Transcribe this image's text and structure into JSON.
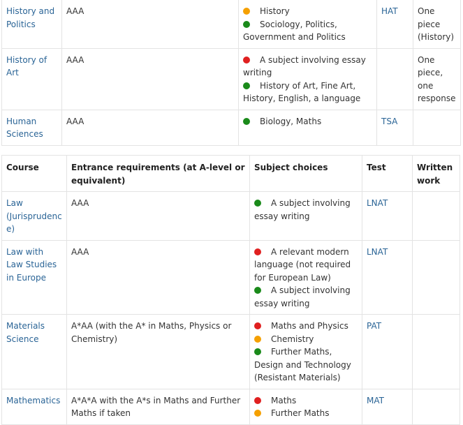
{
  "colors": {
    "red": "#e02020",
    "amber": "#f5a000",
    "green": "#1a8a1a",
    "link": "#2a6496"
  },
  "table1": {
    "rows": [
      {
        "course": "History and Politics",
        "req": "AAA",
        "subjects": [
          {
            "c": "amber",
            "t": "History"
          },
          {
            "c": "green",
            "t": "Sociology, Politics, Government and Politics"
          }
        ],
        "test": "HAT",
        "work": "One piece (History)"
      },
      {
        "course": "History of Art",
        "req": "AAA",
        "subjects": [
          {
            "c": "red",
            "t": "A subject involving essay writing"
          },
          {
            "c": "green",
            "t": "History of Art, Fine Art, History, English, a language"
          }
        ],
        "test": "",
        "work": "One piece, one response"
      },
      {
        "course": "Human Sciences",
        "req": "AAA",
        "subjects": [
          {
            "c": "green",
            "t": "Biology, Maths"
          }
        ],
        "test": "TSA",
        "work": ""
      }
    ]
  },
  "table2": {
    "headers": {
      "course": "Course",
      "req": "Entrance requirements (at A-level or equivalent)",
      "subjects": "Subject choices",
      "test": "Test",
      "work": "Written work"
    },
    "rows": [
      {
        "course": "Law (Jurisprudence)",
        "req": "AAA",
        "subjects": [
          {
            "c": "green",
            "t": "A subject involving essay writing"
          }
        ],
        "test": "LNAT",
        "work": ""
      },
      {
        "course": "Law with Law Studies in Europe",
        "req": "AAA",
        "subjects": [
          {
            "c": "red",
            "t": "A relevant modern language (not required for European Law)"
          },
          {
            "c": "green",
            "t": "A subject involving essay writing"
          }
        ],
        "test": "LNAT",
        "work": ""
      },
      {
        "course": "Materials Science",
        "req": "A*AA (with the A* in Maths, Physics or Chemistry)",
        "subjects": [
          {
            "c": "red",
            "t": "Maths and Physics"
          },
          {
            "c": "amber",
            "t": "Chemistry"
          },
          {
            "c": "green",
            "t": "Further Maths, Design and Technology (Resistant Materials)"
          }
        ],
        "test": "PAT",
        "work": ""
      },
      {
        "course": "Mathematics",
        "req": "A*A*A with the A*s in Maths and Further Maths if taken",
        "subjects": [
          {
            "c": "red",
            "t": "Maths"
          },
          {
            "c": "amber",
            "t": "Further Maths"
          }
        ],
        "test": "MAT",
        "work": ""
      }
    ]
  }
}
